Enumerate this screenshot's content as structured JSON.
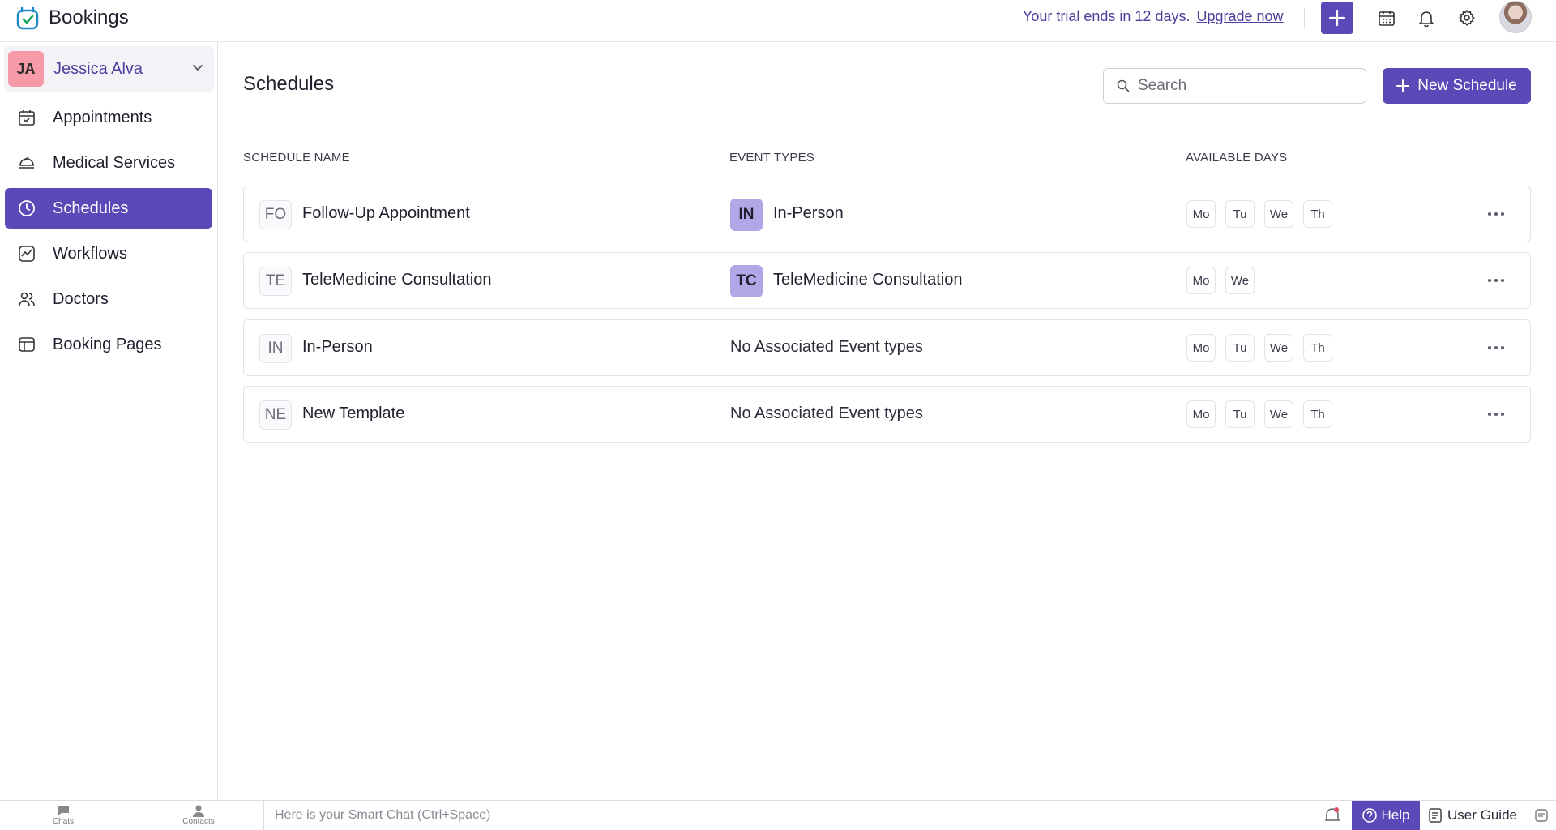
{
  "app": {
    "name": "Bookings",
    "trial_text": "Your trial ends in 12 days.",
    "upgrade_label": "Upgrade now",
    "accent_color": "#5b49b7"
  },
  "header_icons": [
    "plus-icon",
    "calendar-icon",
    "bell-icon",
    "gear-icon",
    "profile-avatar"
  ],
  "user": {
    "initials": "JA",
    "name": "Jessica Alva"
  },
  "sidebar": {
    "items": [
      {
        "label": "Appointments",
        "icon": "calendar-check-icon",
        "active": false
      },
      {
        "label": "Medical Services",
        "icon": "services-icon",
        "active": false
      },
      {
        "label": "Schedules",
        "icon": "clock-icon",
        "active": true
      },
      {
        "label": "Workflows",
        "icon": "workflow-icon",
        "active": false
      },
      {
        "label": "Doctors",
        "icon": "users-icon",
        "active": false
      },
      {
        "label": "Booking Pages",
        "icon": "booking-page-icon",
        "active": false
      }
    ]
  },
  "main": {
    "title": "Schedules",
    "search_placeholder": "Search",
    "new_button": "New Schedule",
    "columns": {
      "name": "SCHEDULE NAME",
      "event_types": "EVENT TYPES",
      "available_days": "AVAILABLE DAYS"
    },
    "rows": [
      {
        "initials": "FO",
        "name": "Follow-Up Appointment",
        "event_badge": "IN",
        "event_name": "In-Person",
        "days": [
          "Mo",
          "Tu",
          "We",
          "Th"
        ]
      },
      {
        "initials": "TE",
        "name": "TeleMedicine Consultation",
        "event_badge": "TC",
        "event_name": "TeleMedicine Consultation",
        "days": [
          "Mo",
          "We"
        ]
      },
      {
        "initials": "IN",
        "name": "In-Person",
        "event_badge": "",
        "event_name": "No Associated Event types",
        "days": [
          "Mo",
          "Tu",
          "We",
          "Th"
        ]
      },
      {
        "initials": "NE",
        "name": "New Template",
        "event_badge": "",
        "event_name": "No Associated Event types",
        "days": [
          "Mo",
          "Tu",
          "We",
          "Th"
        ]
      }
    ]
  },
  "bottombar": {
    "chats": "Chats",
    "contacts": "Contacts",
    "smartchat_placeholder": "Here is your Smart Chat (Ctrl+Space)",
    "help": "Help",
    "user_guide": "User Guide"
  }
}
